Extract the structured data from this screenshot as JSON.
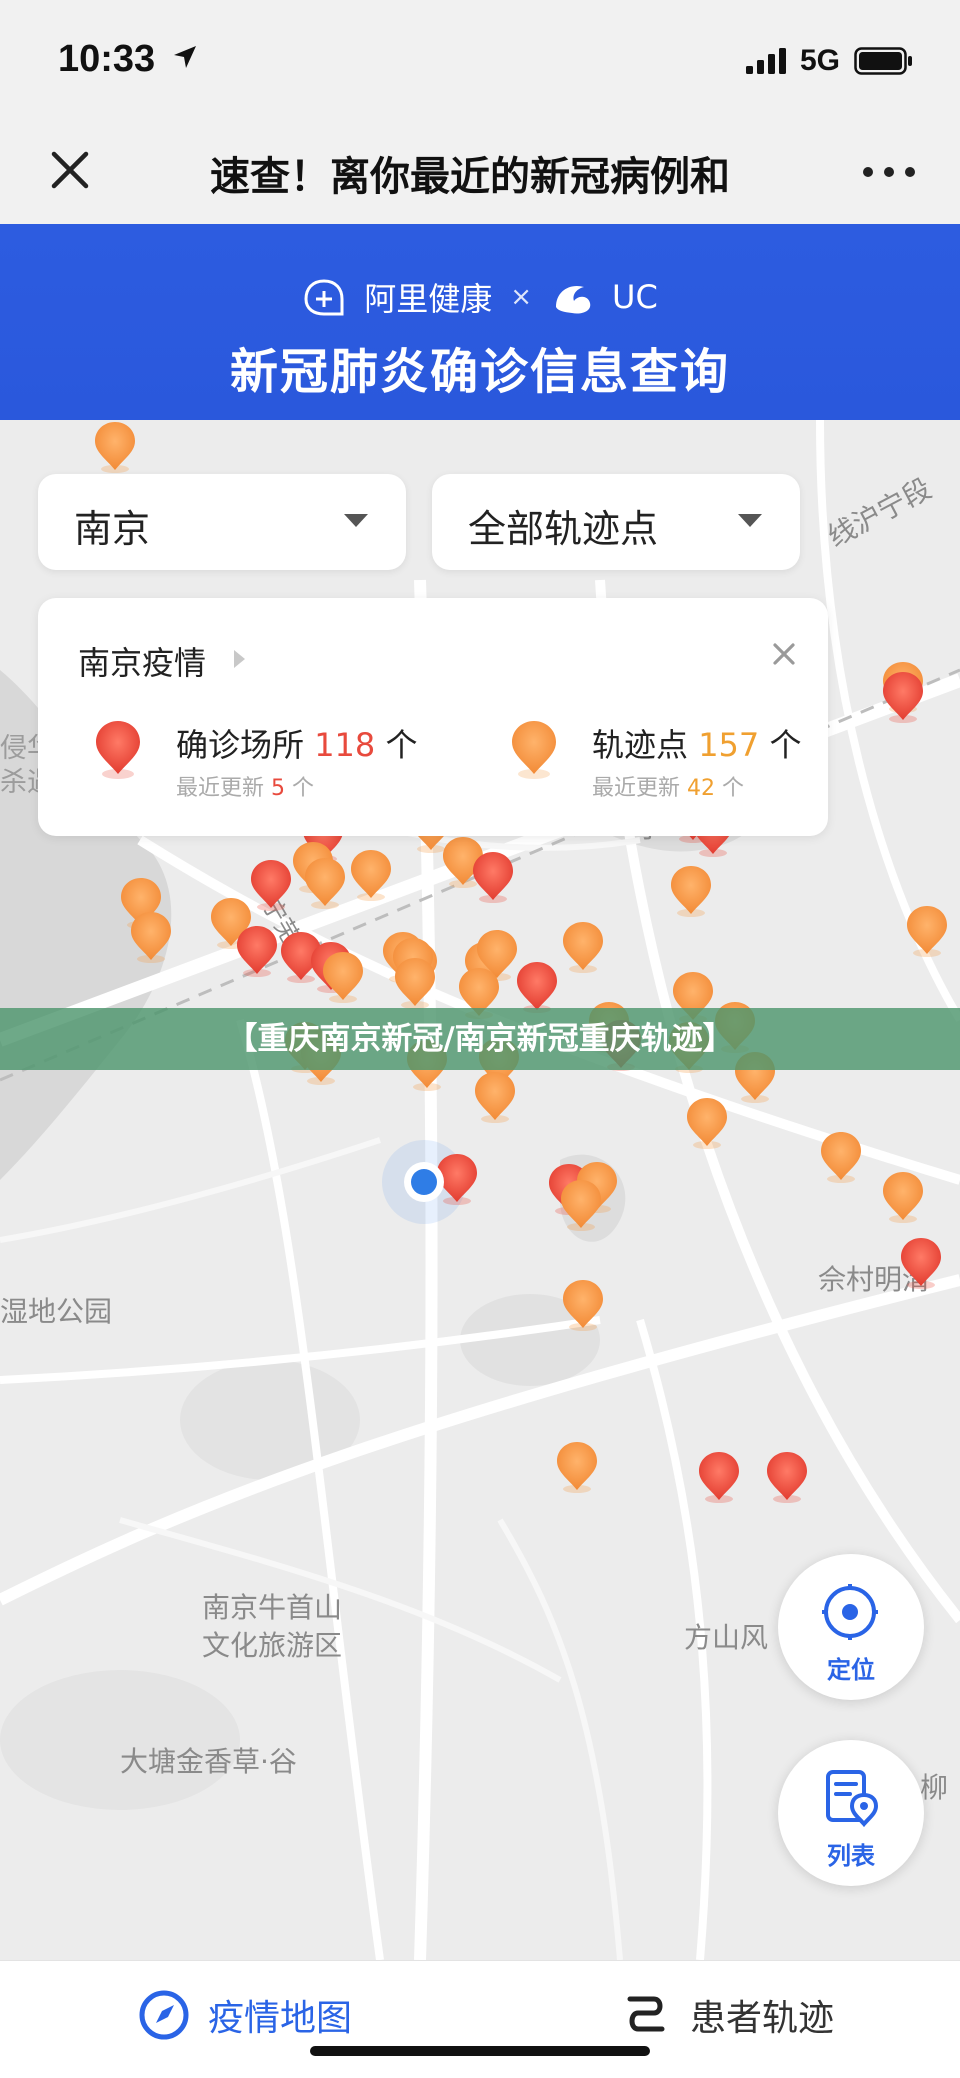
{
  "status_bar": {
    "time": "10:33",
    "network": "5G"
  },
  "title_bar": {
    "title": "速查！离你最近的新冠病例和"
  },
  "banner": {
    "brand_a": "阿里健康",
    "brand_sep": "×",
    "brand_b": "UC",
    "title": "新冠肺炎确诊信息查询"
  },
  "filters": {
    "city": "南京",
    "point_type": "全部轨迹点"
  },
  "info_card": {
    "title": "南京疫情",
    "confirmed": {
      "label": "确诊场所",
      "count": "118",
      "unit": "个",
      "recent_label": "最近更新",
      "recent_count": "5",
      "recent_unit": "个"
    },
    "trace": {
      "label": "轨迹点",
      "count": "157",
      "unit": "个",
      "recent_label": "最近更新",
      "recent_count": "42",
      "recent_unit": "个"
    }
  },
  "overlay_banner": "【重庆南京新冠/南京新冠重庆轨迹】",
  "map_labels": {
    "memorial_1": "侵华日军南京大屠",
    "memorial_2": "杀遇难同胞纪念馆",
    "wetland": "湿地公园",
    "niushou_1": "南京牛首山",
    "niushou_2": "文化旅游区",
    "fangshan": "方山风",
    "yucun": "佘村明清",
    "datang": "大塘金香草·谷",
    "highway": "沪宁",
    "ningshang": "宁",
    "liu": "柳",
    "metro_line": "宁芜线",
    "sha_hu": "线沪宁段"
  },
  "fabs": {
    "locate": "定位",
    "list": "列表"
  },
  "tabs": {
    "map": "疫情地图",
    "trace": "患者轨迹"
  },
  "colors": {
    "brand_blue": "#2a64e6",
    "confirmed_red": "#e84a3d",
    "trace_orange": "#f59a45",
    "overlay_green": "#4e966e"
  }
}
